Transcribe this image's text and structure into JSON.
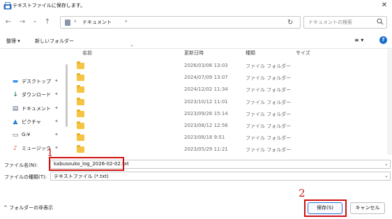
{
  "window": {
    "title": "テキストファイルに保存します。",
    "close_glyph": "✕"
  },
  "nav": {
    "back_glyph": "←",
    "forward_glyph": "→",
    "dropdown_glyph": "⌄",
    "up_glyph": "↑",
    "breadcrumb": "ドキュメント",
    "crumb_sep": "›",
    "addr_dropdown_glyph": "⌄",
    "refresh_glyph": "↻",
    "search_placeholder": "ドキュメントの検索"
  },
  "toolbar": {
    "organize_label": "整理 ▾",
    "new_folder_label": "新しいフォルダー",
    "view_glyph": "≡ ▾",
    "help_glyph": "?"
  },
  "sidebar": {
    "pin_glyph": "📌",
    "items": [
      {
        "label": "デスクトップ",
        "icon": "desktop-icon",
        "glyph": "▬",
        "color": "#3a8ee6"
      },
      {
        "label": "ダウンロード",
        "icon": "download-icon",
        "glyph": "↓",
        "color": "#1f8a4c"
      },
      {
        "label": "ドキュメント",
        "icon": "document-icon",
        "glyph": "▤",
        "color": "#5b6b80"
      },
      {
        "label": "ピクチャ",
        "icon": "pictures-icon",
        "glyph": "▲",
        "color": "#2a7fd0"
      },
      {
        "label": "G:¥",
        "icon": "drive-icon",
        "glyph": "▭",
        "color": "#555555"
      },
      {
        "label": "ミュージック",
        "icon": "music-icon",
        "glyph": "♪",
        "color": "#d9452b"
      }
    ]
  },
  "columns": {
    "name": "名前",
    "modified": "更新日時",
    "type": "種類",
    "size": "サイズ",
    "sort_glyph": "^"
  },
  "rows": [
    {
      "date": "2026/03/06 13:03",
      "type": "ファイル フォルダー"
    },
    {
      "date": "2024/07/09 13:07",
      "type": "ファイル フォルダー"
    },
    {
      "date": "2024/12/02 11:34",
      "type": "ファイル フォルダー"
    },
    {
      "date": "2023/10/12 11:01",
      "type": "ファイル フォルダー"
    },
    {
      "date": "2023/09/26 15:14",
      "type": "ファイル フォルダー"
    },
    {
      "date": "2023/08/12 12:56",
      "type": "ファイル フォルダー"
    },
    {
      "date": "2023/08/18 9:51",
      "type": "ファイル フォルダー"
    },
    {
      "date": "2023/05/29 11:21",
      "type": "ファイル フォルダー"
    }
  ],
  "form": {
    "filename_label": "ファイル名(N):",
    "filename_value": "kabusouko_log_2026-02-02.txt",
    "filetype_label": "ファイルの種類(T):",
    "filetype_value": "テキストファイル (*.txt)",
    "dropdown_glyph": "⌄"
  },
  "footer": {
    "hide_folders_label": "^ フォルダーの非表示",
    "save_label": "保存(S)",
    "cancel_label": "キャンセル"
  },
  "annotations": {
    "marker_1": "1",
    "marker_2": "2",
    "color": "#d01010"
  }
}
